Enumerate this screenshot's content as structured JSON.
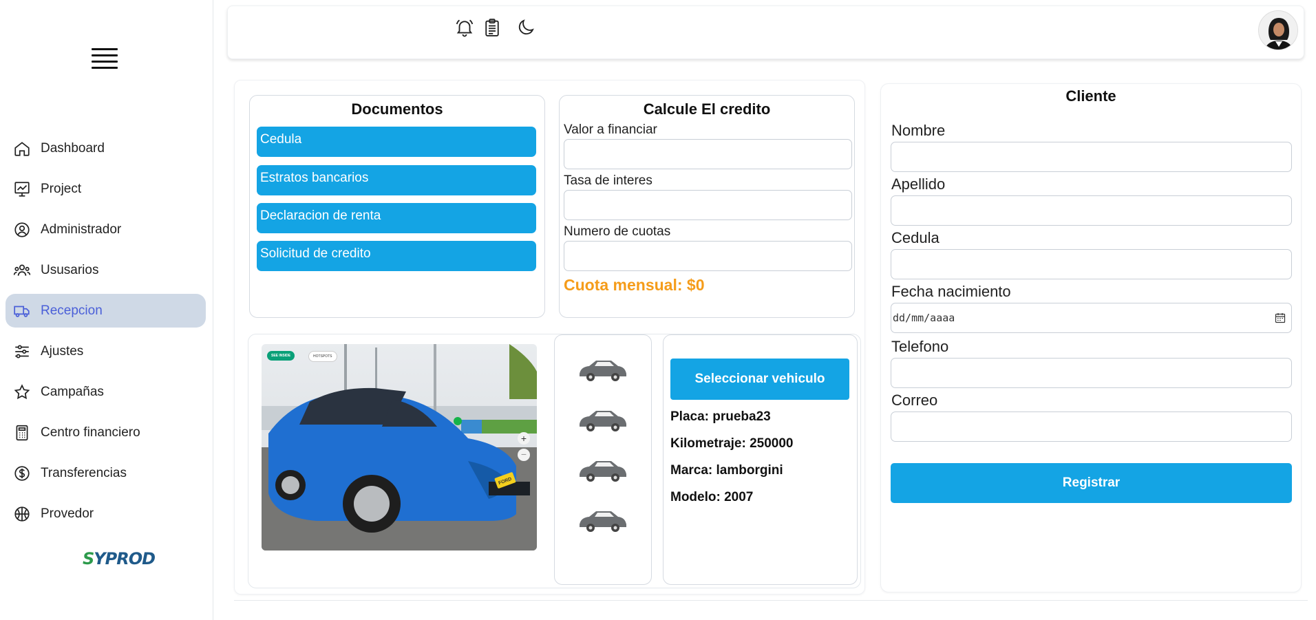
{
  "sidebar": {
    "items": [
      {
        "label": "Dashboard",
        "icon": "home-icon"
      },
      {
        "label": "Project",
        "icon": "chart-board-icon"
      },
      {
        "label": "Administrador",
        "icon": "user-circle-icon"
      },
      {
        "label": "Ususarios",
        "icon": "users-icon"
      },
      {
        "label": "Recepcion",
        "icon": "truck-icon",
        "active": true
      },
      {
        "label": "Ajustes",
        "icon": "sliders-icon"
      },
      {
        "label": "Campañas",
        "icon": "star-icon"
      },
      {
        "label": "Centro financiero",
        "icon": "calculator-icon"
      },
      {
        "label": "Transferencias",
        "icon": "dollar-circle-icon"
      },
      {
        "label": "Provedor",
        "icon": "basketball-icon"
      }
    ],
    "logo_text": "SYPROD"
  },
  "topbar": {
    "icons": [
      "bell-icon",
      "clipboard-icon",
      "moon-icon"
    ]
  },
  "documentos": {
    "title": "Documentos",
    "buttons": [
      "Cedula",
      "Estratos bancarios",
      "Declaracion de renta",
      "Solicitud de credito"
    ]
  },
  "credito": {
    "title": "Calcule El credito",
    "fields": [
      {
        "label": "Valor a financiar",
        "value": ""
      },
      {
        "label": "Tasa de interes",
        "value": ""
      },
      {
        "label": "Numero de cuotas",
        "value": ""
      }
    ],
    "cuota_label": "Cuota mensual: $0"
  },
  "vehiculo": {
    "select_label": "Seleccionar vehiculo",
    "placa": "Placa: prueba23",
    "kilometraje": "Kilometraje: 250000",
    "marca": "Marca: lamborgini",
    "modelo": "Modelo: 2007",
    "photo_badges": [
      "SEE INSIDE",
      "HOTSPOTS"
    ],
    "plate_text": "FORD"
  },
  "cliente": {
    "title": "Cliente",
    "fields": [
      {
        "label": "Nombre",
        "value": ""
      },
      {
        "label": "Apellido",
        "value": ""
      },
      {
        "label": "Cedula",
        "value": ""
      },
      {
        "label": "Fecha nacimiento",
        "placeholder": "dd/mm/aaaa"
      },
      {
        "label": "Telefono",
        "value": ""
      },
      {
        "label": "Correo",
        "value": ""
      }
    ],
    "submit_label": "Registrar"
  },
  "colors": {
    "accent": "#14a4e4",
    "active_bg": "#cfd9e6",
    "active_text": "#4a5fd8",
    "cuota": "#f59c1a"
  }
}
